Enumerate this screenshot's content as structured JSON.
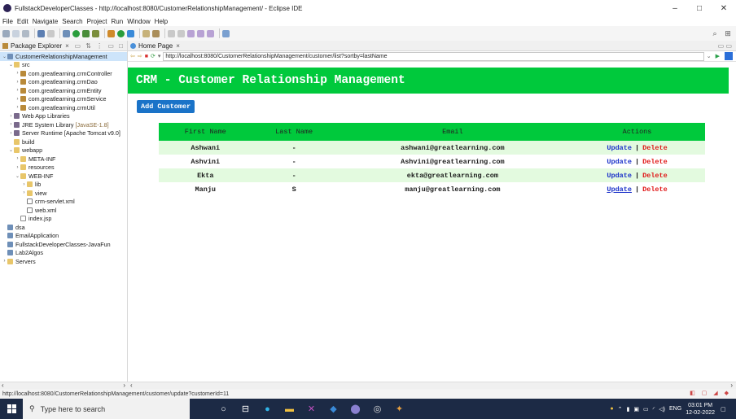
{
  "window": {
    "title": "FullstackDeveloperClasses - http://localhost:8080/CustomerRelationshipManagement/ - Eclipse IDE",
    "minimize": "–",
    "maximize": "□",
    "close": "✕"
  },
  "menu": [
    "File",
    "Edit",
    "Navigate",
    "Search",
    "Project",
    "Run",
    "Window",
    "Help"
  ],
  "explorer": {
    "tab_label": "Package Explorer",
    "tree": [
      {
        "label": "CustomerRelationshipManagement",
        "depth": 0,
        "twisty": "⌄",
        "icon": "project",
        "selected": true
      },
      {
        "label": "src",
        "depth": 1,
        "twisty": "⌄",
        "icon": "folder"
      },
      {
        "label": "com.greatlearning.crmController",
        "depth": 2,
        "twisty": "›",
        "icon": "package"
      },
      {
        "label": "com.greatlearning.crmDao",
        "depth": 2,
        "twisty": "›",
        "icon": "package"
      },
      {
        "label": "com.greatlearning.crmEntity",
        "depth": 2,
        "twisty": "›",
        "icon": "package"
      },
      {
        "label": "com.greatlearning.crmService",
        "depth": 2,
        "twisty": "›",
        "icon": "package"
      },
      {
        "label": "com.greatlearning.crmUtil",
        "depth": 2,
        "twisty": "›",
        "icon": "package"
      },
      {
        "label": "Web App Libraries",
        "depth": 1,
        "twisty": "›",
        "icon": "library"
      },
      {
        "label": "JRE System Library",
        "suffix": "[JavaSE-1.8]",
        "depth": 1,
        "twisty": "›",
        "icon": "library"
      },
      {
        "label": "Server Runtime [Apache Tomcat v9.0]",
        "depth": 1,
        "twisty": "›",
        "icon": "library"
      },
      {
        "label": "build",
        "depth": 1,
        "twisty": "",
        "icon": "folder"
      },
      {
        "label": "webapp",
        "depth": 1,
        "twisty": "⌄",
        "icon": "folder"
      },
      {
        "label": "META-INF",
        "depth": 2,
        "twisty": "›",
        "icon": "folder"
      },
      {
        "label": "resources",
        "depth": 2,
        "twisty": "›",
        "icon": "folder"
      },
      {
        "label": "WEB-INF",
        "depth": 2,
        "twisty": "⌄",
        "icon": "folder"
      },
      {
        "label": "lib",
        "depth": 3,
        "twisty": "›",
        "icon": "folder"
      },
      {
        "label": "view",
        "depth": 3,
        "twisty": "›",
        "icon": "folder"
      },
      {
        "label": "crm-servlet.xml",
        "depth": 3,
        "twisty": "",
        "icon": "xml"
      },
      {
        "label": "web.xml",
        "depth": 3,
        "twisty": "",
        "icon": "xml"
      },
      {
        "label": "index.jsp",
        "depth": 2,
        "twisty": "",
        "icon": "file"
      },
      {
        "label": "dsa",
        "depth": 0,
        "twisty": "",
        "icon": "project"
      },
      {
        "label": "EmailApplication",
        "depth": 0,
        "twisty": "",
        "icon": "project"
      },
      {
        "label": "FullstackDeveloperClasses-JavaFun",
        "depth": 0,
        "twisty": "",
        "icon": "project"
      },
      {
        "label": "Lab2Algos",
        "depth": 0,
        "twisty": "",
        "icon": "project"
      },
      {
        "label": "Servers",
        "depth": 0,
        "twisty": "›",
        "icon": "folder"
      }
    ]
  },
  "browser": {
    "tab_label": "Home Page",
    "url": "http://localhost:8080/CustomerRelationshipManagement/customer/list?sortby=lastName"
  },
  "page": {
    "header": "CRM - Customer Relationship Management",
    "add_button": "Add Customer",
    "columns": [
      "First Name",
      "Last Name",
      "Email",
      "Actions"
    ],
    "rows": [
      {
        "first": "Ashwani",
        "last": "-",
        "email": "ashwani@greatlearning.com",
        "update": "Update",
        "delete": "Delete"
      },
      {
        "first": "Ashvini",
        "last": "-",
        "email": "Ashvini@greatlearning.com",
        "update": "Update",
        "delete": "Delete"
      },
      {
        "first": "Ekta",
        "last": "-",
        "email": "ekta@greatlearning.com",
        "update": "Update",
        "delete": "Delete"
      },
      {
        "first": "Manju",
        "last": "S",
        "email": "manju@greatlearning.com",
        "update": "Update",
        "delete": "Delete"
      }
    ],
    "action_separator": "|"
  },
  "status": {
    "text": "http://localhost:8080/CustomerRelationshipManagement/customer/update?customerId=11"
  },
  "taskbar": {
    "search_placeholder": "Type here to search",
    "time": "03:01 PM",
    "date": "12-02-2022",
    "lang": "ENG"
  },
  "colors": {
    "header_green": "#00c93c",
    "button_blue": "#1a73c8",
    "update_link": "#1a30c9",
    "delete_link": "#e01818",
    "row_alt": "#e3fadf"
  }
}
